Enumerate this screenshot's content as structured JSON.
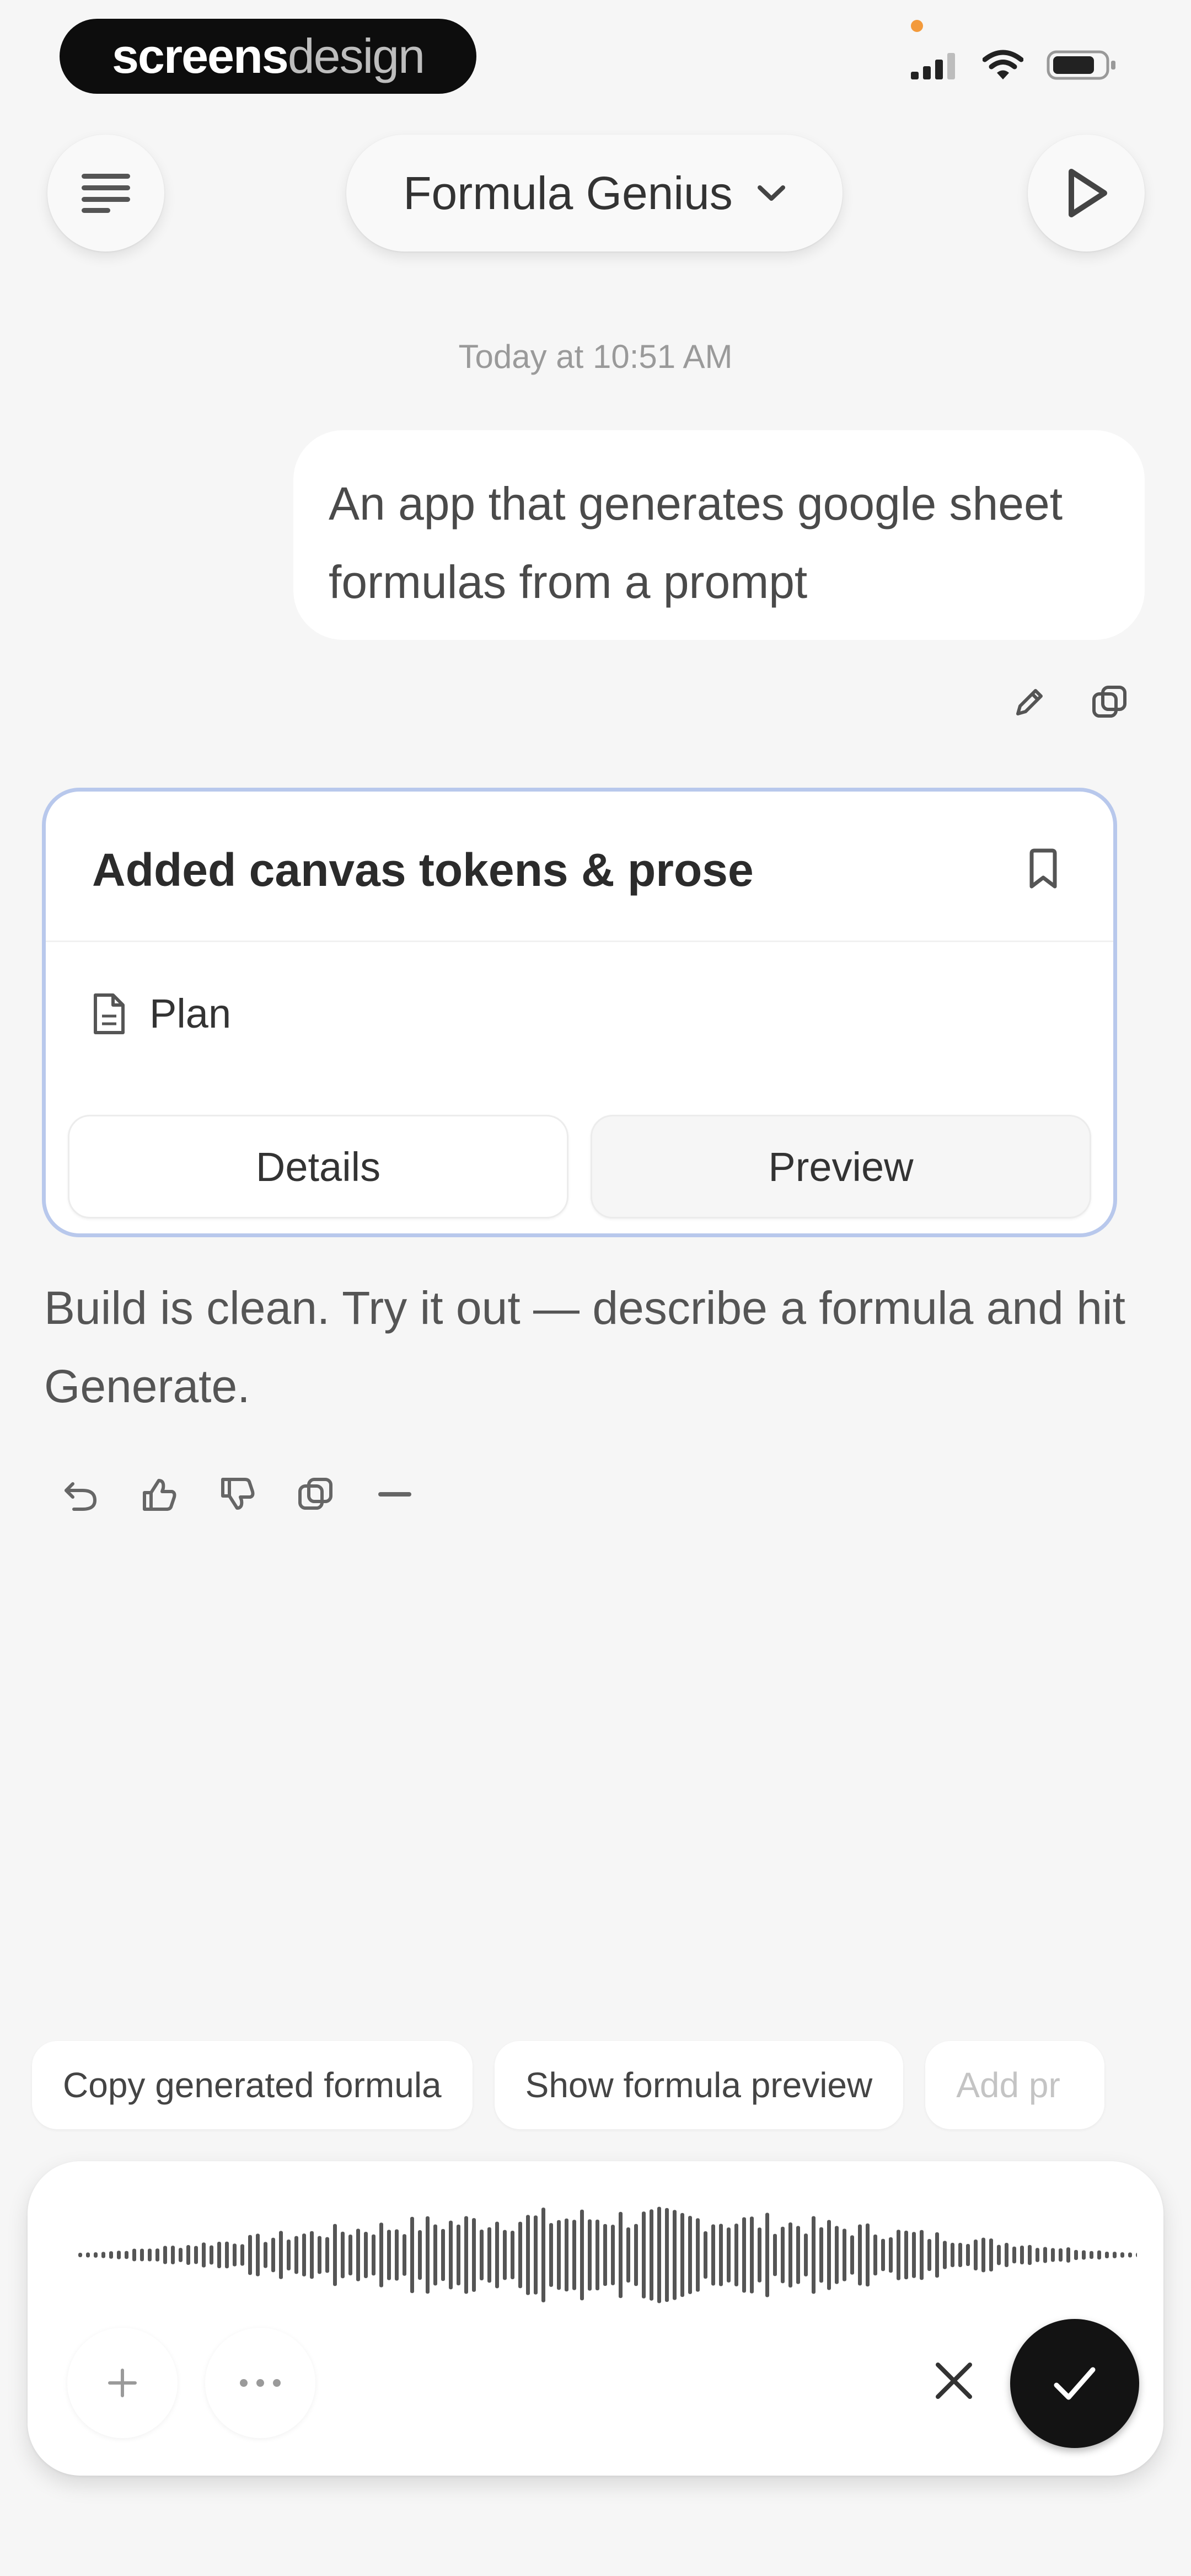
{
  "status_bar": {
    "brand_strong": "screens",
    "brand_light": "design"
  },
  "header": {
    "title": "Formula Genius"
  },
  "chat": {
    "timestamp": "Today at 10:51 AM",
    "user_message": "An app that generates google sheet formulas from a prompt",
    "artifact": {
      "title": "Added canvas tokens & prose",
      "plan_label": "Plan",
      "details_label": "Details",
      "preview_label": "Preview"
    },
    "assistant_message": "Build is clean. Try it out — describe a formula and hit Generate."
  },
  "suggestions": [
    "Copy generated formula",
    "Show formula preview",
    "Add pr"
  ],
  "colors": {
    "background": "#f6f6f6",
    "card_border": "#b8c8ec",
    "brand_pill": "#0d0d0d",
    "recording_dot": "#f39a3b",
    "confirm_button": "#131313"
  }
}
